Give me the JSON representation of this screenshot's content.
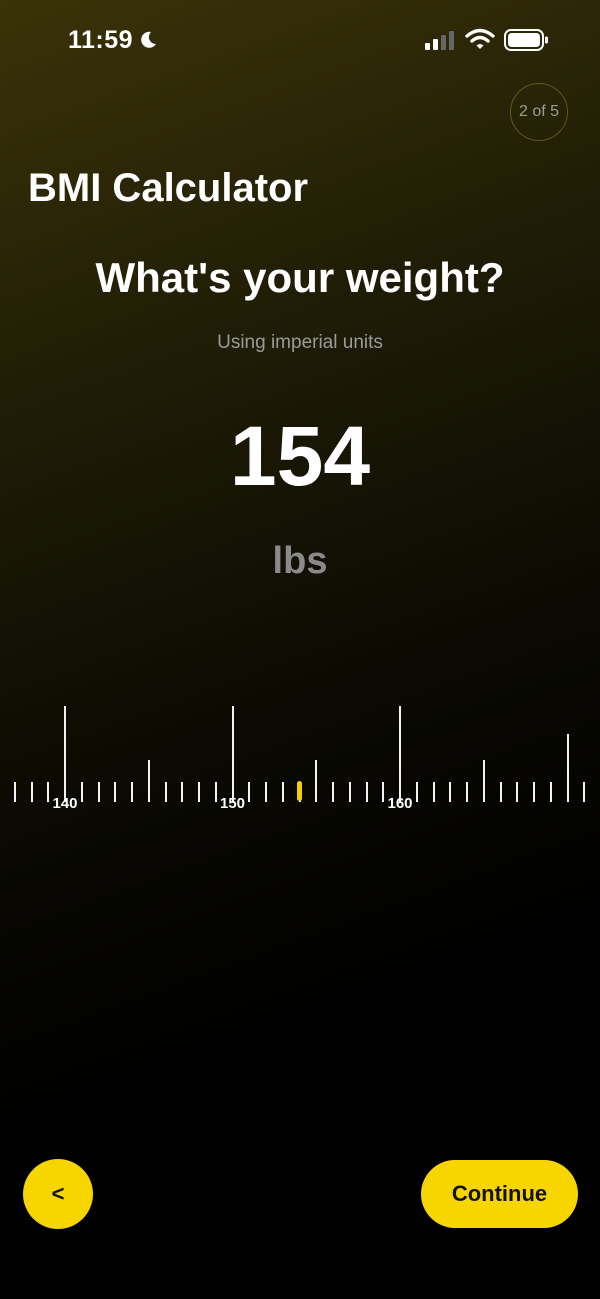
{
  "status_bar": {
    "time": "11:59"
  },
  "step": {
    "label": "2 of 5",
    "current": 2,
    "total": 5
  },
  "header": {
    "app_title": "BMI Calculator"
  },
  "content": {
    "question": "What's your weight?",
    "subtitle": "Using imperial units",
    "weight_value": "154",
    "weight_unit": "lbs"
  },
  "ruler": {
    "selected_value": 154,
    "labels": [
      "140",
      "150",
      "160"
    ]
  },
  "actions": {
    "back_label": "<",
    "continue_label": "Continue"
  },
  "colors": {
    "accent": "#f7d600",
    "background": "#000000"
  }
}
